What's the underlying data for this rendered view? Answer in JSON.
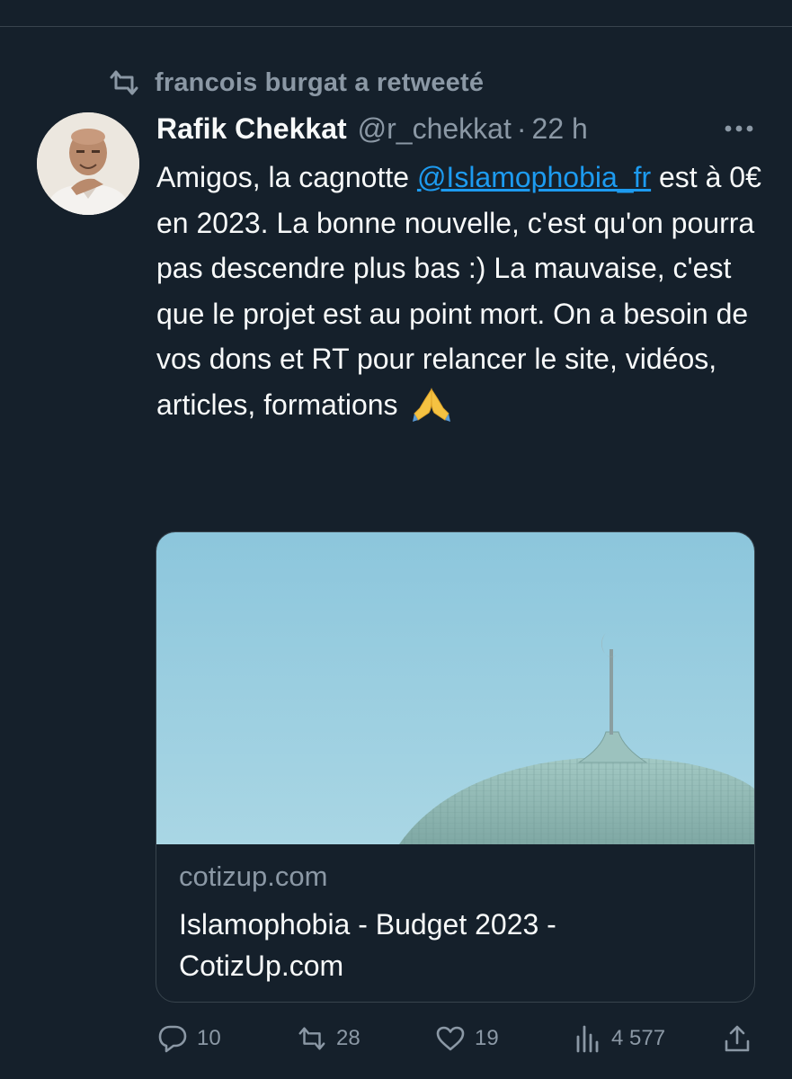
{
  "retweet": {
    "text": "francois burgat a retweeté",
    "icon": "retweet-icon"
  },
  "tweet": {
    "author_name": "Rafik Chekkat",
    "author_handle": "@r_chekkat",
    "separator": "·",
    "time": "22 h",
    "more_icon": "more-icon",
    "text_part1": "Amigos, la cagnotte",
    "mention": "@Islamophobia_fr",
    "text_part2": "est à 0€ en 2023. La bonne nouvelle, c'est qu'on pourra pas descendre plus bas :) La mauvaise, c'est que le projet est au point mort. On a besoin de vos dons et RT pour relancer le site, vidéos, articles, formations",
    "emoji": "folded-hands-emoji"
  },
  "card": {
    "domain": "cotizup.com",
    "title": "Islamophobia - Budget 2023 - CotizUp.com",
    "image_subject": "mosque-dome-photo"
  },
  "actions": {
    "reply_count": "10",
    "retweet_count": "28",
    "like_count": "19",
    "views_count": "4 577",
    "share_icon": "share-icon"
  },
  "colors": {
    "background": "#15202b",
    "text_primary": "#f7f9f9",
    "text_secondary": "#8b98a5",
    "link": "#1d9bf0",
    "border": "#38444d"
  }
}
